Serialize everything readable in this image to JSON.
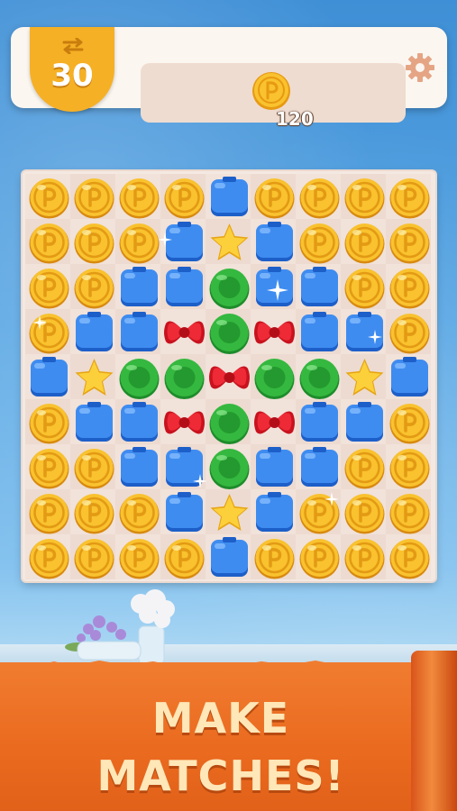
{
  "hud": {
    "moves_remaining": "30",
    "coin_count": "120",
    "colors": {
      "badge": "#f6b025",
      "panel": "#efdcd0",
      "gear": "#e5a585"
    }
  },
  "board": {
    "rows": 9,
    "cols": 9,
    "legend": {
      "C": "coin",
      "B": "blue-suitcase",
      "S": "yellow-star",
      "G": "green-button",
      "R": "red-bow"
    },
    "grid": [
      [
        "C",
        "C",
        "C",
        "C",
        "B",
        "C",
        "C",
        "C",
        "C"
      ],
      [
        "C",
        "C",
        "C",
        "B",
        "S",
        "B",
        "C",
        "C",
        "C"
      ],
      [
        "C",
        "C",
        "B",
        "B",
        "G",
        "B",
        "B",
        "C",
        "C"
      ],
      [
        "C",
        "B",
        "B",
        "R",
        "G",
        "R",
        "B",
        "B",
        "C"
      ],
      [
        "B",
        "S",
        "G",
        "G",
        "R",
        "G",
        "G",
        "S",
        "B"
      ],
      [
        "C",
        "B",
        "B",
        "R",
        "G",
        "R",
        "B",
        "B",
        "C"
      ],
      [
        "C",
        "C",
        "B",
        "B",
        "G",
        "B",
        "B",
        "C",
        "C"
      ],
      [
        "C",
        "C",
        "C",
        "B",
        "S",
        "B",
        "C",
        "C",
        "C"
      ],
      [
        "C",
        "C",
        "C",
        "C",
        "B",
        "C",
        "C",
        "C",
        "C"
      ]
    ]
  },
  "banner": {
    "line1": "MAKE",
    "line2": "MATCHES!",
    "color": "#ea6a1f",
    "text_color": "#ffe7b8"
  }
}
